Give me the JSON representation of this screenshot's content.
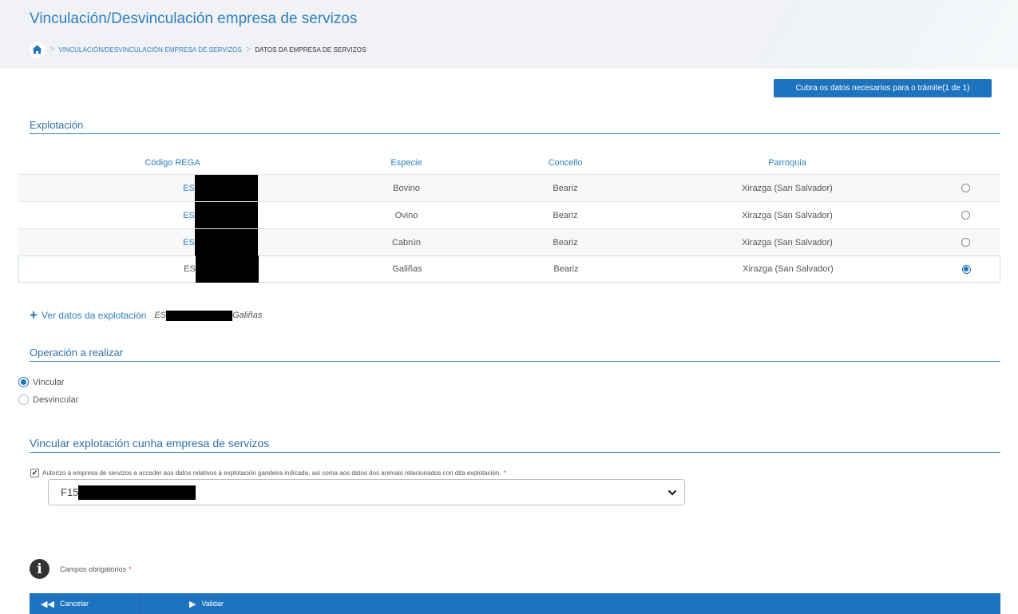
{
  "header": {
    "title": "Vinculación/Desvinculación empresa de servizos",
    "breadcrumb": {
      "home_icon": "home-icon",
      "items": [
        "VINCULACIÓN/DESVINCULACIÓN EMPRESA DE SERVIZOS",
        "DATOS DA EMPRESA DE SERVIZOS"
      ]
    }
  },
  "step_button": "Cubra os datos necesarios para o trámite(1 de 1)",
  "explotacion": {
    "section_title": "Explotación",
    "columns": [
      "Código REGA",
      "Especie",
      "Concello",
      "Parroquia"
    ],
    "rows": [
      {
        "rega": "ES",
        "especie": "Bovino",
        "concello": "Beariz",
        "parroquia": "Xirazga (San Salvador)",
        "selected": false
      },
      {
        "rega": "ES",
        "especie": "Ovino",
        "concello": "Beariz",
        "parroquia": "Xirazga (San Salvador)",
        "selected": false
      },
      {
        "rega": "ES",
        "especie": "Cabrún",
        "concello": "Beariz",
        "parroquia": "Xirazga (San Salvador)",
        "selected": false
      },
      {
        "rega": "ES",
        "especie": "Galiñas",
        "concello": "Beariz",
        "parroquia": "Xirazga (San Salvador)",
        "selected": true
      }
    ],
    "ver_datos": {
      "label": "Ver datos da explotación",
      "code_prefix": "ES",
      "species": "Galiñas"
    }
  },
  "operacion": {
    "section_title": "Operación a realizar",
    "options": [
      {
        "label": "Vincular",
        "selected": true
      },
      {
        "label": "Desvincular",
        "selected": false
      }
    ]
  },
  "vincular": {
    "section_title": "Vincular explotación cunha empresa de servizos",
    "consent_text": "Autorizo á empresa de servizos a acceder aos datos relativos á explotación gandeira indicada, así coma aos datos dos animais relacionados con dita explotación.",
    "consent_checked": true,
    "required_mark": "*",
    "select_value_prefix": "F15"
  },
  "footnote": {
    "text": "Campos obrigatorios",
    "required_mark": "*"
  },
  "footer": {
    "cancel_label": "Cancelar",
    "validate_label": "Validar"
  },
  "colors": {
    "accent": "#1e73be",
    "link": "#2f80bf",
    "header_bg": "#f0f2f5",
    "required": "#d9534f"
  }
}
